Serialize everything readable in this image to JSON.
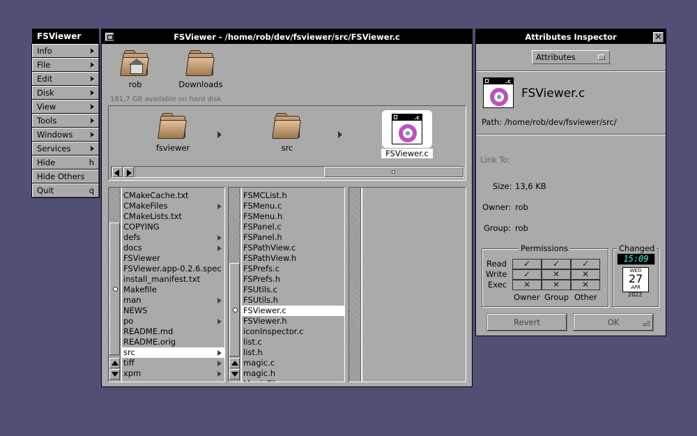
{
  "menu": {
    "title": "FSViewer",
    "items": [
      {
        "label": "Info",
        "sub": true
      },
      {
        "label": "File",
        "sub": true
      },
      {
        "label": "Edit",
        "sub": true
      },
      {
        "label": "Disk",
        "sub": true
      },
      {
        "label": "View",
        "sub": true
      },
      {
        "label": "Tools",
        "sub": true
      },
      {
        "label": "Windows",
        "sub": true
      },
      {
        "label": "Services",
        "sub": true
      },
      {
        "label": "Hide",
        "key": "h"
      },
      {
        "label": "Hide Others",
        "key": ""
      },
      {
        "label": "Quit",
        "key": "q"
      }
    ]
  },
  "main": {
    "title": "FSViewer - /home/rob/dev/fsviewer/src/FSViewer.c",
    "shelf": [
      {
        "label": "rob",
        "icon": "home-folder-icon"
      },
      {
        "label": "Downloads",
        "icon": "folder-icon"
      }
    ],
    "disk_info": "181,7 GB available on hard disk",
    "path": [
      {
        "label": "fsviewer",
        "icon": "folder-icon"
      },
      {
        "label": "src",
        "icon": "folder-icon"
      },
      {
        "label": "FSViewer.c",
        "icon": "c-source-file-icon",
        "badge": ".c"
      }
    ],
    "column1": [
      {
        "label": "CMakeCache.txt"
      },
      {
        "label": "CMakeFiles",
        "sub": true
      },
      {
        "label": "CMakeLists.txt"
      },
      {
        "label": "COPYING"
      },
      {
        "label": "defs",
        "sub": true
      },
      {
        "label": "docs",
        "sub": true
      },
      {
        "label": "FSViewer"
      },
      {
        "label": "FSViewer.app-0.2.6.spec"
      },
      {
        "label": "install_manifest.txt"
      },
      {
        "label": "Makefile"
      },
      {
        "label": "man",
        "sub": true
      },
      {
        "label": "NEWS"
      },
      {
        "label": "po",
        "sub": true
      },
      {
        "label": "README.md"
      },
      {
        "label": "README.orig"
      },
      {
        "label": "src",
        "sub": true,
        "selected": true
      },
      {
        "label": "tiff",
        "sub": true
      },
      {
        "label": "xpm",
        "sub": true
      }
    ],
    "column2": [
      {
        "label": "FSMCList.h"
      },
      {
        "label": "FSMenu.c"
      },
      {
        "label": "FSMenu.h"
      },
      {
        "label": "FSPanel.c"
      },
      {
        "label": "FSPanel.h"
      },
      {
        "label": "FSPathView.c"
      },
      {
        "label": "FSPathView.h"
      },
      {
        "label": "FSPrefs.c"
      },
      {
        "label": "FSPrefs.h"
      },
      {
        "label": "FSUtils.c"
      },
      {
        "label": "FSUtils.h"
      },
      {
        "label": "FSViewer.c",
        "selected": true
      },
      {
        "label": "FSViewer.h"
      },
      {
        "label": "iconInspector.c"
      },
      {
        "label": "list.c"
      },
      {
        "label": "list.h"
      },
      {
        "label": "magic.c"
      },
      {
        "label": "magic.h"
      },
      {
        "label": "MagicFile..."
      }
    ]
  },
  "inspector": {
    "title": "Attributes Inspector",
    "popup_value": "Attributes",
    "file_name": "FSViewer.c",
    "file_badge": ".c",
    "path": "Path: /home/rob/dev/fsviewer/src/",
    "link_label": "Link To:",
    "size_label": "Size:",
    "size_value": "13,6 KB",
    "owner_label": "Owner:",
    "owner_value": "rob",
    "group_label": "Group:",
    "group_value": "rob",
    "permissions": {
      "title": "Permissions",
      "rows": [
        "Read",
        "Write",
        "Exec"
      ],
      "cols": [
        "Owner",
        "Group",
        "Other"
      ],
      "grid": [
        [
          "✓",
          "✓",
          "✓"
        ],
        [
          "✓",
          "✕",
          "✕"
        ],
        [
          "✕",
          "✕",
          "✕"
        ]
      ]
    },
    "changed": {
      "title": "Changed",
      "time": "15:09",
      "weekday": "WED",
      "day": "27",
      "month": "APR",
      "year": "2022"
    },
    "revert_label": "Revert",
    "ok_label": "OK"
  }
}
